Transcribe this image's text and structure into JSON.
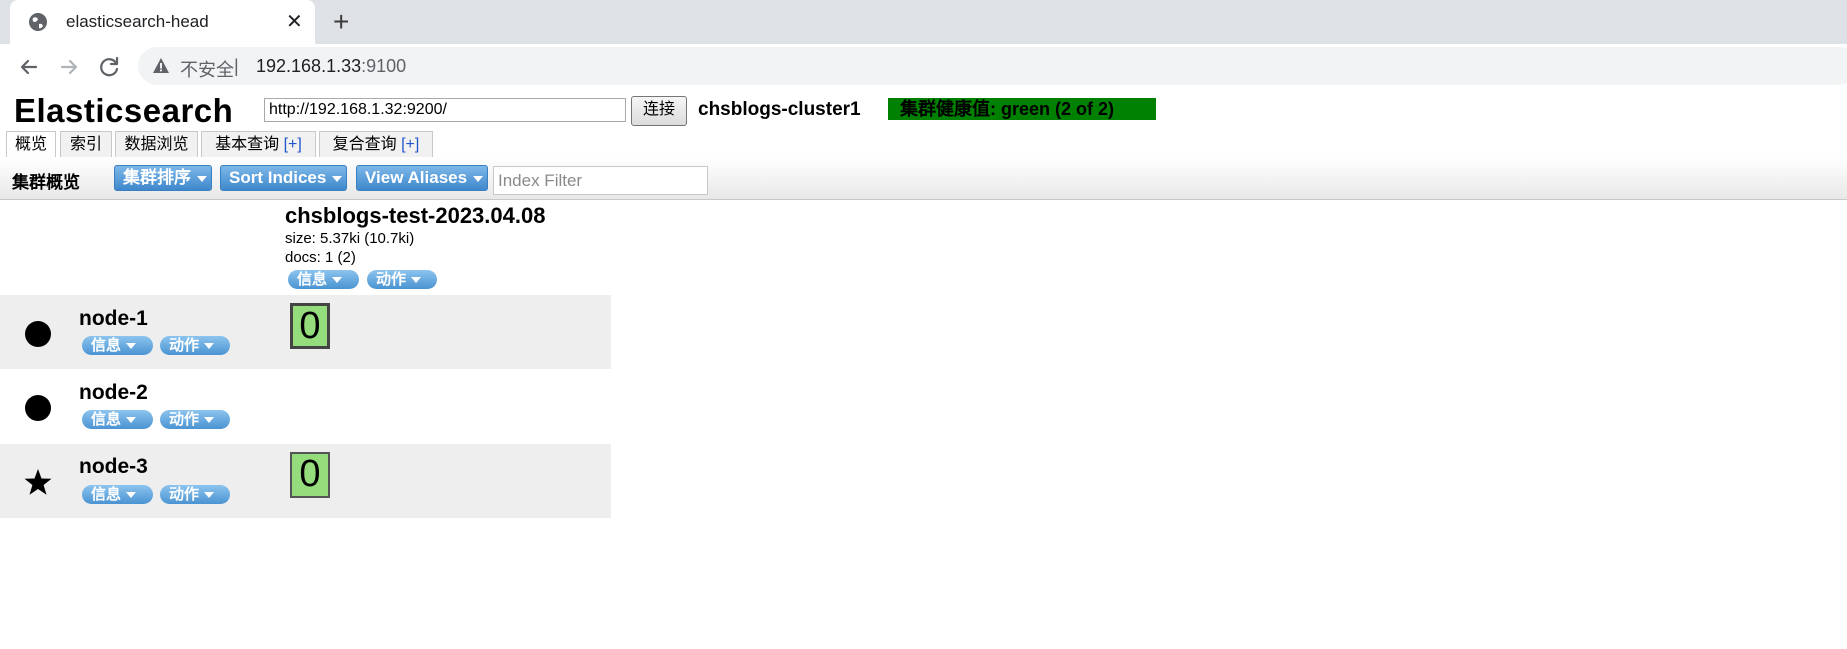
{
  "browser": {
    "tab_title": "elasticsearch-head",
    "security_label": "不安全",
    "separator": "|",
    "url_host": "192.168.1.33",
    "url_port": ":9100"
  },
  "app": {
    "brand": "Elasticsearch",
    "connect_url": "http://192.168.1.32:9200/",
    "connect_label": "连接",
    "cluster_name": "chsblogs-cluster1",
    "health": "集群健康值: green (2 of 2)",
    "health_color": "#008000"
  },
  "tabs": [
    {
      "label": "概览"
    },
    {
      "label": "索引"
    },
    {
      "label": "数据浏览"
    },
    {
      "label": "基本查询",
      "plus": "[+]"
    },
    {
      "label": "复合查询",
      "plus": "[+]"
    }
  ],
  "toolbar": {
    "title": "集群概览",
    "sort_cluster": "集群排序",
    "sort_indices": "Sort Indices",
    "view_aliases": "View Aliases",
    "filter_placeholder": "Index Filter"
  },
  "index": {
    "name": "chsblogs-test-2023.04.08",
    "size": "size: 5.37ki (10.7ki)",
    "docs": "docs: 1 (2)",
    "info_label": "信息",
    "action_label": "动作"
  },
  "nodes": [
    {
      "name": "node-1",
      "icon": "circle-icon",
      "shard": "0",
      "info_label": "信息",
      "action_label": "动作"
    },
    {
      "name": "node-2",
      "icon": "circle-icon",
      "shard": "",
      "info_label": "信息",
      "action_label": "动作"
    },
    {
      "name": "node-3",
      "icon": "star-icon",
      "shard": "0",
      "info_label": "信息",
      "action_label": "动作"
    }
  ]
}
